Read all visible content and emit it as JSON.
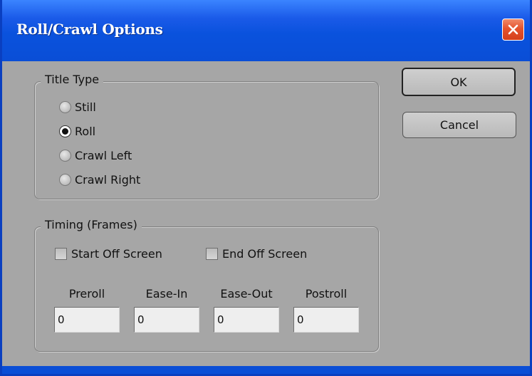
{
  "window": {
    "title": "Roll/Crawl Options",
    "close_icon": "close-x-icon",
    "colors": {
      "titlebar": "#0a4ed6",
      "close": "#e5532d",
      "client": "#a6a6a6"
    }
  },
  "title_type": {
    "legend": "Title Type",
    "options": [
      {
        "label": "Still",
        "checked": false
      },
      {
        "label": "Roll",
        "checked": true
      },
      {
        "label": "Crawl Left",
        "checked": false
      },
      {
        "label": "Crawl Right",
        "checked": false
      }
    ]
  },
  "timing": {
    "legend": "Timing (Frames)",
    "start_off_screen": {
      "label": "Start Off Screen",
      "checked": false
    },
    "end_off_screen": {
      "label": "End Off Screen",
      "checked": false
    },
    "fields": [
      {
        "label": "Preroll",
        "value": "0"
      },
      {
        "label": "Ease-In",
        "value": "0"
      },
      {
        "label": "Ease-Out",
        "value": "0"
      },
      {
        "label": "Postroll",
        "value": "0"
      }
    ]
  },
  "buttons": {
    "ok": "OK",
    "cancel": "Cancel"
  }
}
